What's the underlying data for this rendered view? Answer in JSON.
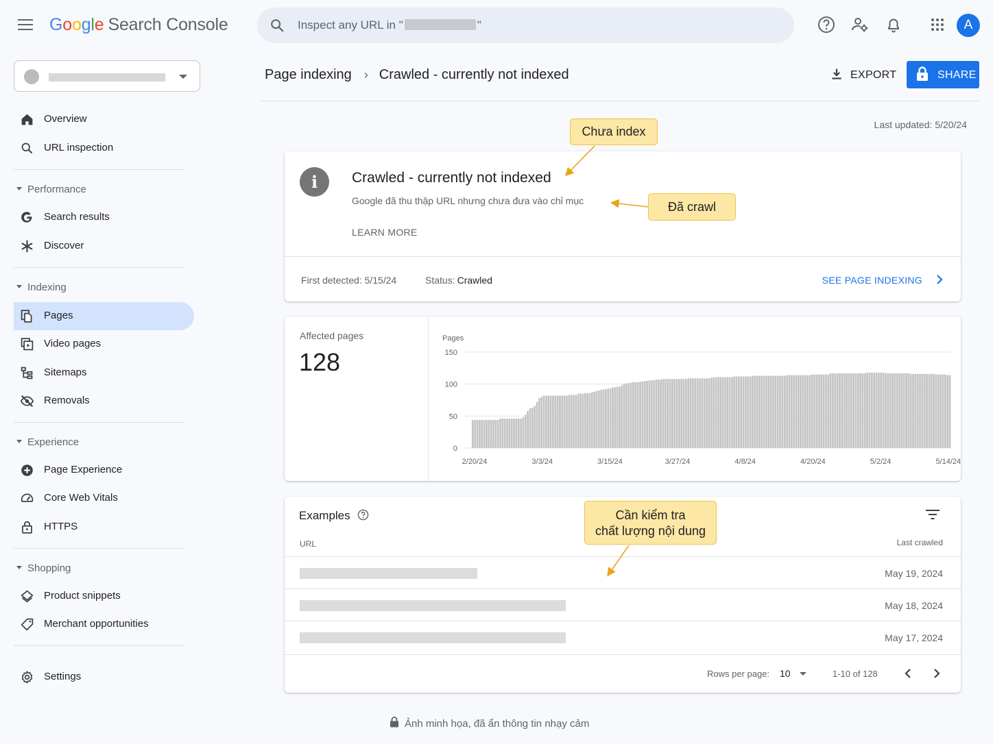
{
  "app": {
    "logo_letters": [
      "G",
      "o",
      "o",
      "g",
      "l",
      "e"
    ],
    "logo_rest": "Search Console",
    "avatar_letter": "A"
  },
  "search": {
    "prefix": "Inspect any URL in \"",
    "suffix": "\""
  },
  "sidebar": {
    "overview": "Overview",
    "url_inspection": "URL inspection",
    "section_performance": "Performance",
    "search_results": "Search results",
    "discover": "Discover",
    "section_indexing": "Indexing",
    "pages": "Pages",
    "video_pages": "Video pages",
    "sitemaps": "Sitemaps",
    "removals": "Removals",
    "section_experience": "Experience",
    "page_experience": "Page Experience",
    "core_web_vitals": "Core Web Vitals",
    "https": "HTTPS",
    "section_shopping": "Shopping",
    "product_snippets": "Product snippets",
    "merchant_opportunities": "Merchant opportunities",
    "settings": "Settings"
  },
  "header": {
    "breadcrumb_parent": "Page indexing",
    "breadcrumb_current": "Crawled - currently not indexed",
    "export_label": "EXPORT",
    "share_label": "SHARE",
    "last_updated": "Last updated: 5/20/24"
  },
  "info_card": {
    "title": "Crawled - currently not indexed",
    "description": "Google đã thu thập URL nhưng chưa đưa vào chỉ mục",
    "learn_more": "LEARN MORE",
    "first_detected": "First detected: 5/15/24",
    "status_label": "Status:",
    "status_value": "Crawled",
    "see_page_indexing": "SEE PAGE INDEXING"
  },
  "affected": {
    "label": "Affected pages",
    "value": "128"
  },
  "chart_data": {
    "type": "bar",
    "title": "",
    "ylabel": "Pages",
    "xlabel": "",
    "ylim": [
      0,
      150
    ],
    "y_ticks": [
      0,
      50,
      100,
      150
    ],
    "x_tick_labels": [
      "2/20/24",
      "3/3/24",
      "3/15/24",
      "3/27/24",
      "4/8/24",
      "4/20/24",
      "5/2/24",
      "5/14/24"
    ],
    "start_date": "2024-02-20",
    "values": [
      44,
      44,
      44,
      44,
      44,
      44,
      44,
      44,
      44,
      44,
      44,
      44,
      46,
      46,
      46,
      46,
      46,
      46,
      46,
      46,
      46,
      46,
      48,
      52,
      58,
      62,
      63,
      66,
      72,
      78,
      80,
      82,
      82,
      82,
      82,
      82,
      82,
      82,
      82,
      82,
      82,
      82,
      83,
      83,
      83,
      83,
      85,
      85,
      85,
      86,
      86,
      86,
      87,
      88,
      89,
      90,
      91,
      92,
      92,
      93,
      93,
      95,
      95,
      96,
      96,
      98,
      101,
      101,
      102,
      102,
      103,
      103,
      103,
      104,
      104,
      105,
      105,
      106,
      106,
      106,
      107,
      107,
      107,
      108,
      108,
      108,
      108,
      108,
      108,
      108,
      108,
      108,
      108,
      108,
      109,
      109,
      109,
      109,
      109,
      109,
      109,
      109,
      109,
      109,
      110,
      110,
      111,
      111,
      111,
      111,
      111,
      111,
      111,
      111,
      112,
      112,
      112,
      112,
      112,
      112,
      112,
      112,
      113,
      113,
      113,
      113,
      113,
      113,
      113,
      113,
      113,
      113,
      113,
      113,
      113,
      113,
      113,
      114,
      114,
      114,
      114,
      114,
      114,
      114,
      114,
      114,
      114,
      114,
      115,
      115,
      115,
      115,
      115,
      115,
      115,
      115,
      117,
      117,
      117,
      117,
      117,
      117,
      117,
      117,
      117,
      117,
      117,
      117,
      117,
      117,
      117,
      117,
      118,
      118,
      118,
      118,
      118,
      118,
      118,
      118,
      117,
      117,
      117,
      117,
      117,
      117,
      117,
      117,
      117,
      117,
      117,
      116,
      116,
      116,
      116,
      116,
      116,
      116,
      116,
      116,
      116,
      116,
      115,
      115,
      115,
      115,
      115,
      114,
      114
    ],
    "series_color": "#c4c4c4"
  },
  "examples": {
    "title": "Examples",
    "url_header": "URL",
    "crawled_header": "Last crawled",
    "rows": [
      {
        "date": "May 19, 2024"
      },
      {
        "date": "May 18, 2024"
      },
      {
        "date": "May 17, 2024"
      }
    ],
    "rows_per_page_label": "Rows per page:",
    "rows_per_page_value": "10",
    "range": "1-10 of 128"
  },
  "callouts": {
    "chua_index": "Chưa index",
    "da_crawl": "Đã crawl",
    "can_kiem_tra_line1": "Cần kiểm tra",
    "can_kiem_tra_line2": "chất lượng nội dung"
  },
  "footer": {
    "note": "Ảnh minh họa, đã ẩn thông tin nhạy cảm"
  },
  "colors": {
    "accent": "#1a73e8",
    "active_nav": "#d3e3fd",
    "callout_bg": "#fde7a5",
    "callout_border": "#f0c24a",
    "arrow": "#e8a41a"
  }
}
